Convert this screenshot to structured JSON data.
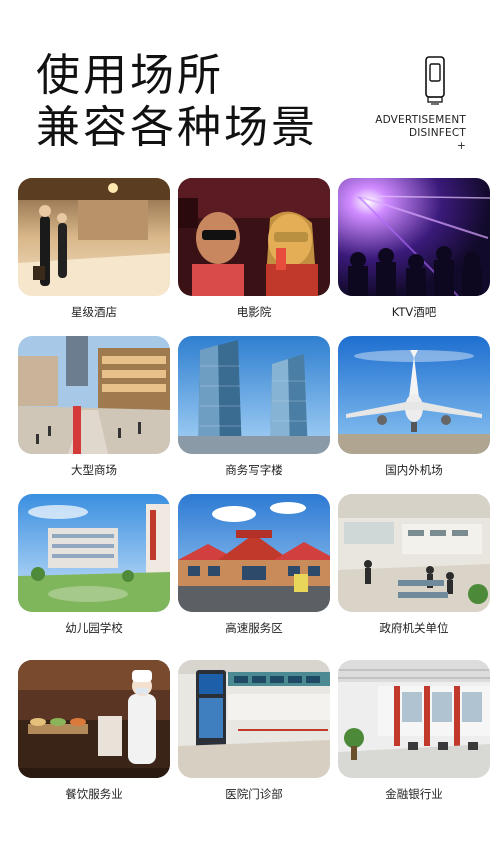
{
  "header": {
    "title_line1": "使用场所",
    "title_line2": "兼容各种场景",
    "badge_line1": "ADVERTISEMENT",
    "badge_line2": "DISINFECT",
    "badge_line3": "+",
    "badge_icon": "device-icon"
  },
  "scenes": [
    {
      "label": "星级酒店",
      "icon": "hotel-photo"
    },
    {
      "label": "电影院",
      "icon": "cinema-photo"
    },
    {
      "label": "KTV酒吧",
      "icon": "ktv-photo"
    },
    {
      "label": "大型商场",
      "icon": "mall-photo"
    },
    {
      "label": "商务写字楼",
      "icon": "office-photo"
    },
    {
      "label": "国内外机场",
      "icon": "airport-photo"
    },
    {
      "label": "幼儿园学校",
      "icon": "school-photo"
    },
    {
      "label": "高速服务区",
      "icon": "service-area-photo"
    },
    {
      "label": "政府机关单位",
      "icon": "government-photo"
    },
    {
      "label": "餐饮服务业",
      "icon": "restaurant-photo"
    },
    {
      "label": "医院门诊部",
      "icon": "hospital-photo"
    },
    {
      "label": "金融银行业",
      "icon": "bank-photo"
    }
  ]
}
